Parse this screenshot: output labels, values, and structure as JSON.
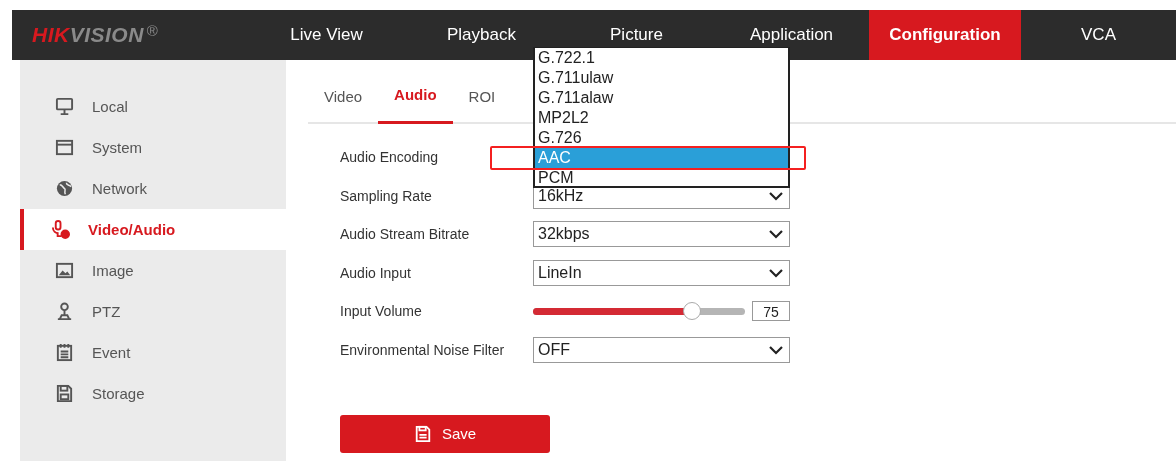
{
  "brand": {
    "logo": "HIKVISION",
    "mark": "®"
  },
  "nav": [
    {
      "label": "Live View",
      "selected": false
    },
    {
      "label": "Playback",
      "selected": false
    },
    {
      "label": "Picture",
      "selected": false
    },
    {
      "label": "Application",
      "selected": false
    },
    {
      "label": "Configuration",
      "selected": true
    },
    {
      "label": "VCA",
      "selected": false
    }
  ],
  "sidebar": {
    "items": [
      {
        "label": "Local",
        "selected": false
      },
      {
        "label": "System",
        "selected": false
      },
      {
        "label": "Network",
        "selected": false
      },
      {
        "label": "Video/Audio",
        "selected": true
      },
      {
        "label": "Image",
        "selected": false
      },
      {
        "label": "PTZ",
        "selected": false
      },
      {
        "label": "Event",
        "selected": false
      },
      {
        "label": "Storage",
        "selected": false
      }
    ]
  },
  "tabs": [
    {
      "label": "Video",
      "selected": false
    },
    {
      "label": "Audio",
      "selected": true
    },
    {
      "label": "ROI",
      "selected": false
    }
  ],
  "form": [
    {
      "kind": "dropdown",
      "label": "Audio Encoding",
      "options": [
        {
          "label": "G.722.1",
          "selected": false
        },
        {
          "label": "G.711ulaw",
          "selected": false
        },
        {
          "label": "G.711alaw",
          "selected": false
        },
        {
          "label": "MP2L2",
          "selected": false
        },
        {
          "label": "G.726",
          "selected": false
        },
        {
          "label": "AAC",
          "selected": true
        },
        {
          "label": "PCM",
          "selected": false
        }
      ]
    },
    {
      "kind": "select",
      "label": "Sampling Rate",
      "value": "16kHz"
    },
    {
      "kind": "select",
      "label": "Audio Stream Bitrate",
      "value": "32kbps"
    },
    {
      "kind": "select",
      "label": "Audio Input",
      "value": "LineIn"
    },
    {
      "kind": "slider",
      "label": "Input Volume",
      "level": 0.75,
      "value": "75"
    },
    {
      "kind": "select",
      "label": "Environmental Noise Filter",
      "value": "OFF"
    }
  ],
  "save_button": "Save"
}
